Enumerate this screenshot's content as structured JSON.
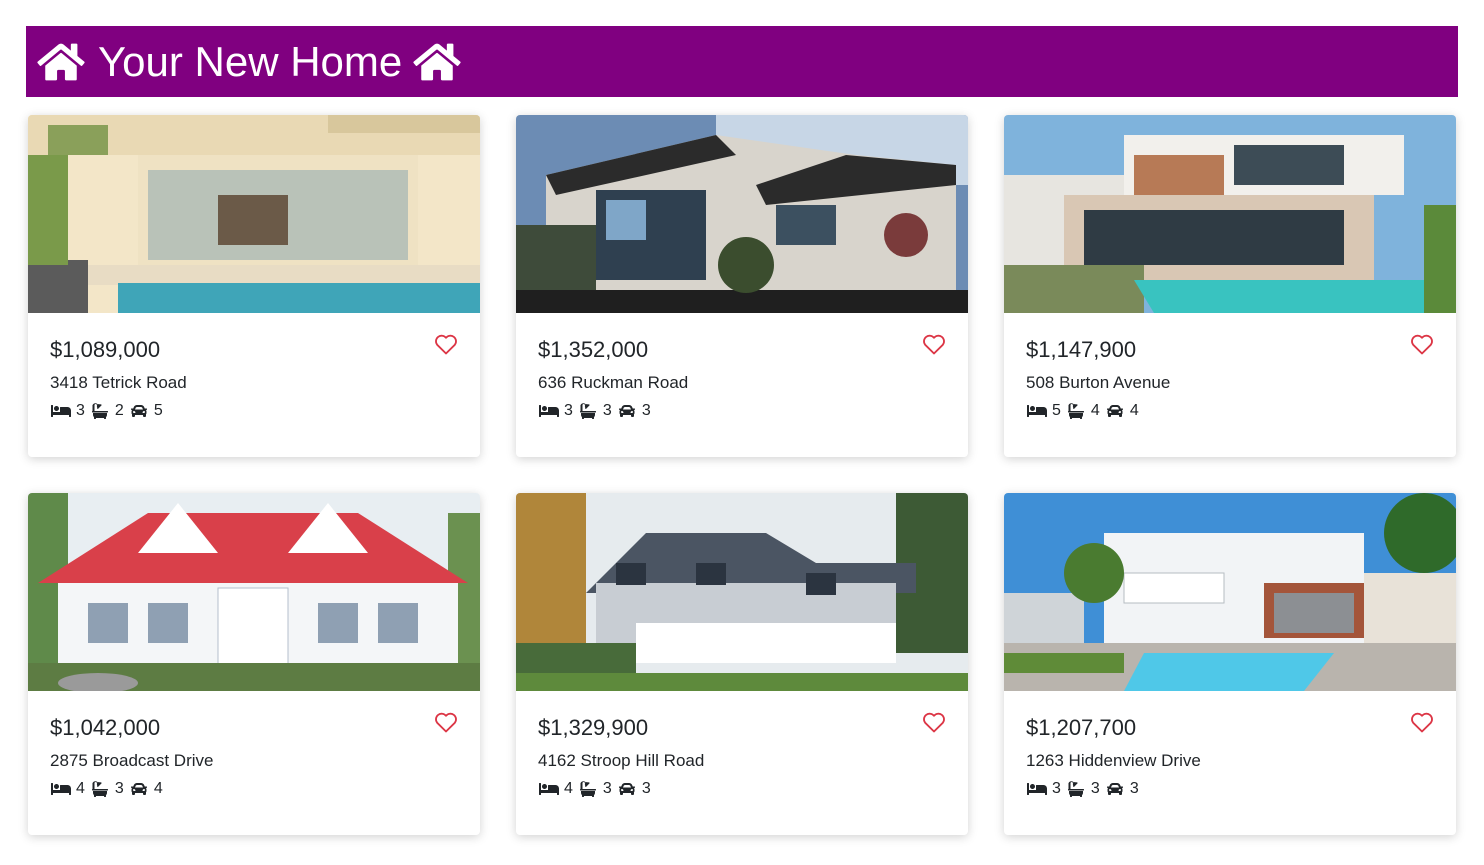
{
  "header": {
    "title": "Your New Home",
    "left_icon": "house-icon",
    "right_icon": "house-icon",
    "background": "#800080"
  },
  "icons": {
    "favorite": "heart-outline-icon",
    "bed": "bed-icon",
    "bath": "bath-icon",
    "car": "car-icon"
  },
  "colors": {
    "heart": "#dc3545"
  },
  "listings": [
    {
      "price": "$1,089,000",
      "address": "3418 Tetrick Road",
      "beds": "3",
      "baths": "2",
      "cars": "5"
    },
    {
      "price": "$1,352,000",
      "address": "636 Ruckman Road",
      "beds": "3",
      "baths": "3",
      "cars": "3"
    },
    {
      "price": "$1,147,900",
      "address": "508 Burton Avenue",
      "beds": "5",
      "baths": "4",
      "cars": "4"
    },
    {
      "price": "$1,042,000",
      "address": "2875 Broadcast Drive",
      "beds": "4",
      "baths": "3",
      "cars": "4"
    },
    {
      "price": "$1,329,900",
      "address": "4162 Stroop Hill Road",
      "beds": "4",
      "baths": "3",
      "cars": "3"
    },
    {
      "price": "$1,207,700",
      "address": "1263 Hiddenview Drive",
      "beds": "3",
      "baths": "3",
      "cars": "3"
    }
  ]
}
